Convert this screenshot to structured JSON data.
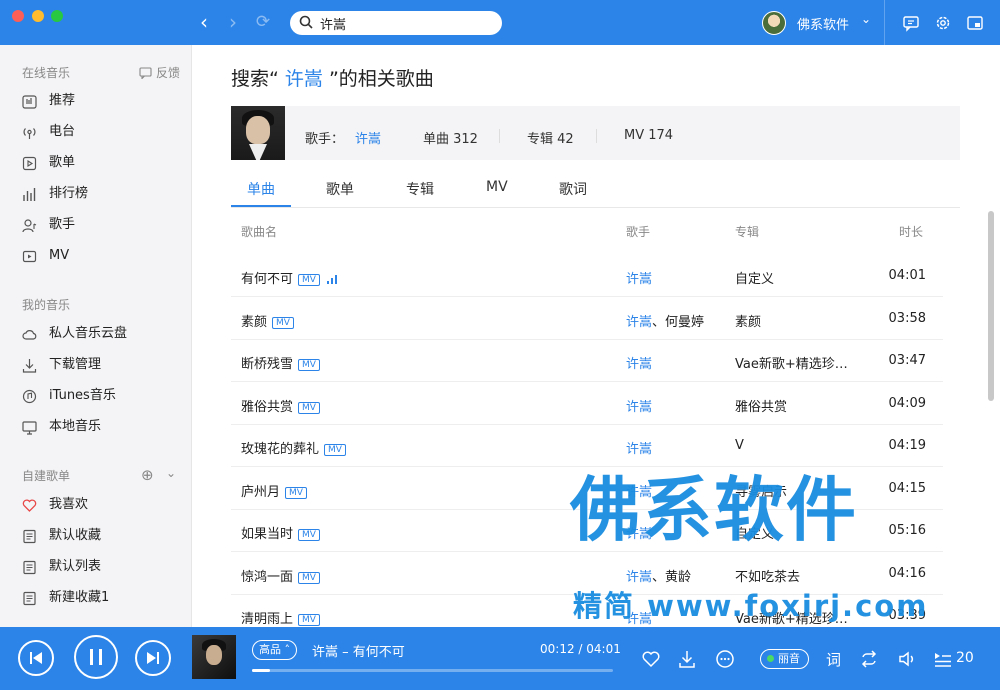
{
  "search": {
    "value": "许嵩"
  },
  "user": {
    "name": "佛系软件"
  },
  "sidebar": {
    "online_title": "在线音乐",
    "feedback": "反馈",
    "online_items": [
      {
        "label": "推荐"
      },
      {
        "label": "电台"
      },
      {
        "label": "歌单"
      },
      {
        "label": "排行榜"
      },
      {
        "label": "歌手"
      },
      {
        "label": "MV"
      }
    ],
    "my_title": "我的音乐",
    "my_items": [
      {
        "label": "私人音乐云盘"
      },
      {
        "label": "下载管理"
      },
      {
        "label": "iTunes音乐"
      },
      {
        "label": "本地音乐"
      }
    ],
    "playlist_title": "自建歌单",
    "playlist_items": [
      {
        "label": "我喜欢"
      },
      {
        "label": "默认收藏"
      },
      {
        "label": "默认列表"
      },
      {
        "label": "新建收藏1"
      }
    ]
  },
  "main": {
    "title_prefix": "搜索“",
    "title_keyword": "许嵩",
    "title_suffix": "”的相关歌曲",
    "artist": {
      "label": "歌手：",
      "name": "许嵩",
      "songs": "单曲 312",
      "albums": "专辑 42",
      "mv": "MV 174"
    },
    "tabs": [
      {
        "label": "单曲"
      },
      {
        "label": "歌单"
      },
      {
        "label": "专辑"
      },
      {
        "label": "MV"
      },
      {
        "label": "歌词"
      }
    ],
    "columns": {
      "song": "歌曲名",
      "artist": "歌手",
      "album": "专辑",
      "duration": "时长"
    },
    "mv_badge": "MV",
    "rows": [
      {
        "song": "有何不可",
        "artist": "许嵩",
        "artist2": "",
        "album": "自定义",
        "duration": "04:01"
      },
      {
        "song": "素颜",
        "artist": "许嵩",
        "artist2": "、何曼婷",
        "album": "素颜",
        "duration": "03:58"
      },
      {
        "song": "断桥残雪",
        "artist": "许嵩",
        "artist2": "",
        "album": "Vae新歌+精选珍…",
        "duration": "03:47"
      },
      {
        "song": "雅俗共赏",
        "artist": "许嵩",
        "artist2": "",
        "album": "雅俗共赏",
        "duration": "04:09"
      },
      {
        "song": "玫瑰花的葬礼",
        "artist": "许嵩",
        "artist2": "",
        "album": "V",
        "duration": "04:19"
      },
      {
        "song": "庐州月",
        "artist": "许嵩",
        "artist2": "",
        "album": "寻雾启示",
        "duration": "04:15"
      },
      {
        "song": "如果当时",
        "artist": "许嵩",
        "artist2": "",
        "album": "自定义",
        "duration": "05:16"
      },
      {
        "song": "惊鸿一面",
        "artist": "许嵩",
        "artist2": "、黄龄",
        "album": "不如吃茶去",
        "duration": "04:16"
      },
      {
        "song": "清明雨上",
        "artist": "许嵩",
        "artist2": "",
        "album": "Vae新歌+精选珍…",
        "duration": "03:39"
      }
    ]
  },
  "watermark": {
    "big": "佛系软件",
    "small": "精简 www.foxirj.com"
  },
  "player": {
    "quality": "高品",
    "now_playing": "许嵩 – 有何不可",
    "time": "00:12 / 04:01",
    "progress": 0.05,
    "lossless": "丽音",
    "playlist_count": "20"
  },
  "colors": {
    "accent": "#2c84e8"
  }
}
